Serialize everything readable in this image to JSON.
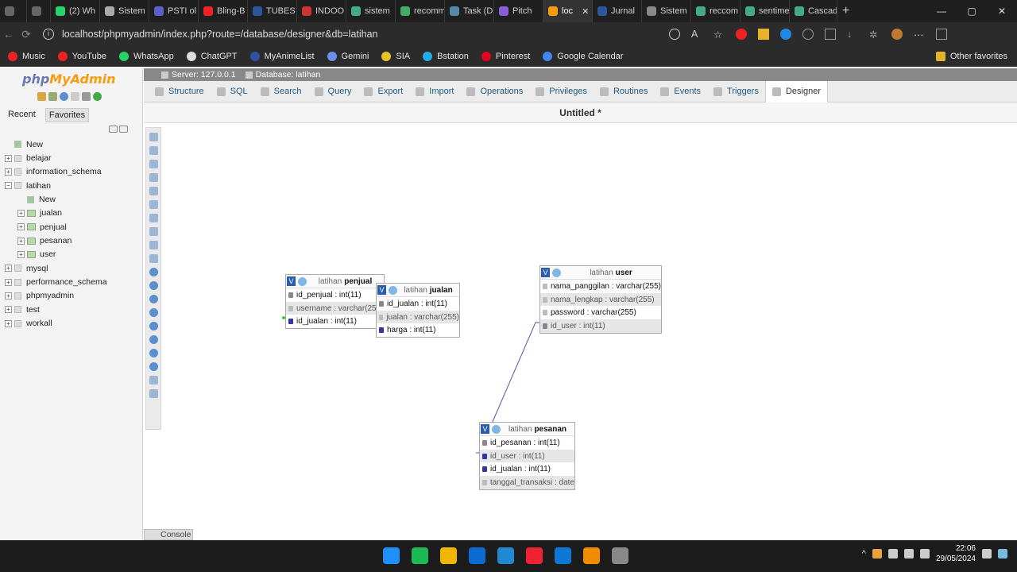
{
  "browser": {
    "tabs": [
      {
        "label": "",
        "color": "#666"
      },
      {
        "label": "",
        "color": "#666"
      },
      {
        "label": "(2) Wh",
        "color": "#25d366"
      },
      {
        "label": "Sistem",
        "color": "#aaa"
      },
      {
        "label": "PSTI ol",
        "color": "#5b5fc7"
      },
      {
        "label": "Bling-B",
        "color": "#e22"
      },
      {
        "label": "TUBES",
        "color": "#2b579a"
      },
      {
        "label": "INDOO",
        "color": "#c33"
      },
      {
        "label": "sistem",
        "color": "#4a8"
      },
      {
        "label": "recomm",
        "color": "#4a6"
      },
      {
        "label": "Task (D",
        "color": "#58a"
      },
      {
        "label": "Pitch",
        "color": "#8a5cd6"
      },
      {
        "label": "loc",
        "color": "#f89c0e"
      },
      {
        "label": "Jurnal",
        "color": "#2b579a"
      },
      {
        "label": "Sistem",
        "color": "#888"
      },
      {
        "label": "reccom",
        "color": "#4a8"
      },
      {
        "label": "sentime",
        "color": "#4a8"
      },
      {
        "label": "Cascad",
        "color": "#4a8"
      }
    ],
    "active_tab": 12,
    "url": "localhost/phpmyadmin/index.php?route=/database/designer&db=latihan",
    "bookmarks": [
      {
        "label": "Music",
        "color": "#e22"
      },
      {
        "label": "YouTube",
        "color": "#e22"
      },
      {
        "label": "WhatsApp",
        "color": "#25d366"
      },
      {
        "label": "ChatGPT",
        "color": "#ddd"
      },
      {
        "label": "MyAnimeList",
        "color": "#2e51a2"
      },
      {
        "label": "Gemini",
        "color": "#6a8fe6"
      },
      {
        "label": "SIA",
        "color": "#e6c229"
      },
      {
        "label": "Bstation",
        "color": "#23ade5"
      },
      {
        "label": "Pinterest",
        "color": "#e60023"
      },
      {
        "label": "Google Calendar",
        "color": "#4285f4"
      }
    ],
    "other_favorites": "Other favorites"
  },
  "pma": {
    "logo_php": "php",
    "logo_my": "MyAdmin",
    "tab_recent": "Recent",
    "tab_favorites": "Favorites",
    "tree": [
      {
        "label": "New",
        "level": 0,
        "kind": "new"
      },
      {
        "label": "belajar",
        "level": 0,
        "kind": "db"
      },
      {
        "label": "information_schema",
        "level": 0,
        "kind": "db"
      },
      {
        "label": "latihan",
        "level": 0,
        "kind": "db",
        "expanded": true
      },
      {
        "label": "New",
        "level": 1,
        "kind": "new"
      },
      {
        "label": "jualan",
        "level": 1,
        "kind": "table"
      },
      {
        "label": "penjual",
        "level": 1,
        "kind": "table"
      },
      {
        "label": "pesanan",
        "level": 1,
        "kind": "table"
      },
      {
        "label": "user",
        "level": 1,
        "kind": "table"
      },
      {
        "label": "mysql",
        "level": 0,
        "kind": "db"
      },
      {
        "label": "performance_schema",
        "level": 0,
        "kind": "db"
      },
      {
        "label": "phpmyadmin",
        "level": 0,
        "kind": "db"
      },
      {
        "label": "test",
        "level": 0,
        "kind": "db"
      },
      {
        "label": "workall",
        "level": 0,
        "kind": "db"
      }
    ],
    "breadcrumb_server": "Server: 127.0.0.1",
    "breadcrumb_db": "Database: latihan",
    "nav": [
      "Structure",
      "SQL",
      "Search",
      "Query",
      "Export",
      "Import",
      "Operations",
      "Privileges",
      "Routines",
      "Events",
      "Triggers",
      "Designer"
    ],
    "active_nav": 11,
    "designer_title": "Untitled *",
    "console": "Console"
  },
  "designer": {
    "tables": [
      {
        "db": "latihan",
        "name": "penjual",
        "columns": [
          {
            "text": "id_penjual : int(11)",
            "key": "pk"
          },
          {
            "text": "username : varchar(255)",
            "key": "none",
            "alt": true
          },
          {
            "text": "id_jualan : int(11)",
            "key": "hash"
          }
        ]
      },
      {
        "db": "latihan",
        "name": "jualan",
        "columns": [
          {
            "text": "id_jualan : int(11)",
            "key": "pk"
          },
          {
            "text": "jualan : varchar(255)",
            "key": "none",
            "alt": true
          },
          {
            "text": "harga : int(11)",
            "key": "hash"
          }
        ]
      },
      {
        "db": "latihan",
        "name": "user",
        "columns": [
          {
            "text": "nama_panggilan : varchar(255)",
            "key": "none"
          },
          {
            "text": "nama_lengkap : varchar(255)",
            "key": "none",
            "alt": true
          },
          {
            "text": "password : varchar(255)",
            "key": "none"
          },
          {
            "text": "id_user : int(11)",
            "key": "pk",
            "alt": true
          }
        ]
      },
      {
        "db": "latihan",
        "name": "pesanan",
        "columns": [
          {
            "text": "id_pesanan : int(11)",
            "key": "pk"
          },
          {
            "text": "id_user : int(11)",
            "key": "hash",
            "alt": true
          },
          {
            "text": "id_jualan : int(11)",
            "key": "hash"
          },
          {
            "text": "tanggal_transaksi : date",
            "key": "none",
            "alt": true
          }
        ]
      }
    ]
  },
  "taskbar": {
    "time": "22:06",
    "date": "29/05/2024",
    "apps": [
      "#1e90ff",
      "#1db954",
      "#f2b600",
      "#0b6bd3",
      "#1f8ad2",
      "#e23",
      "#0a78d4",
      "#f28c00",
      "#888"
    ]
  }
}
